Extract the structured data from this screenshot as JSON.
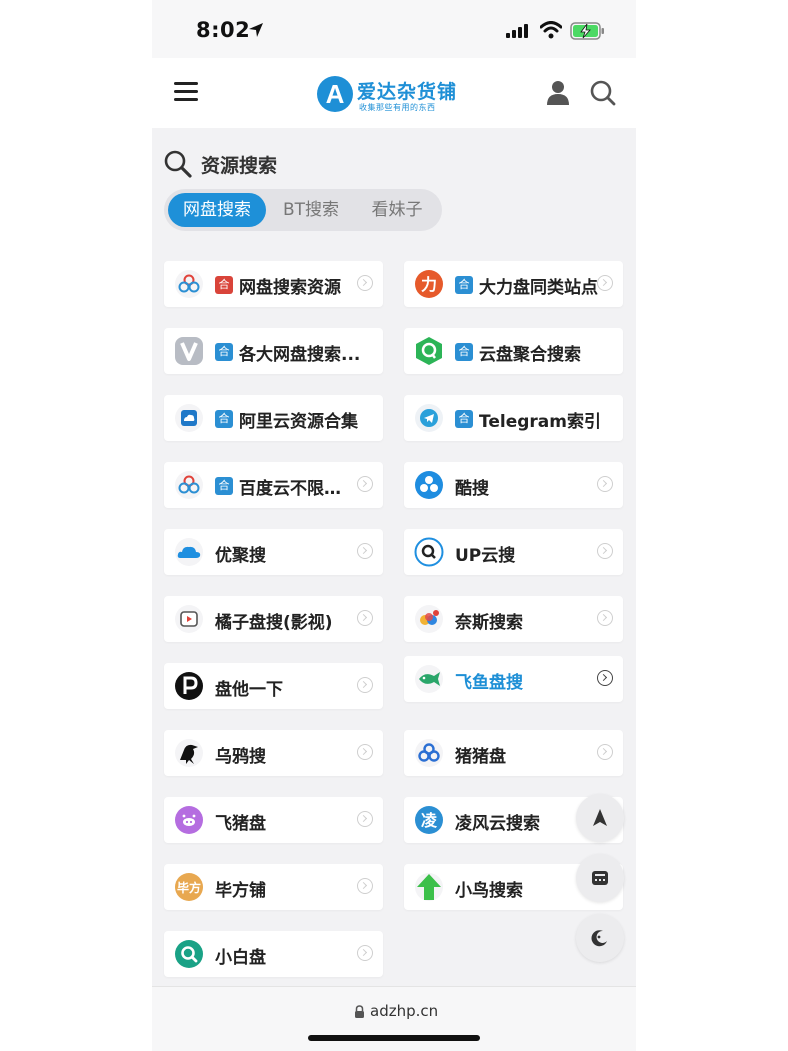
{
  "status_bar": {
    "time": "8:02"
  },
  "header": {
    "logo_letter": "A",
    "logo_title": "爱达杂货铺",
    "logo_subtitle": "收集那些有用的东西"
  },
  "search_section": {
    "title": "资源搜索",
    "tabs": [
      {
        "label": "网盘搜索",
        "active": true
      },
      {
        "label": "BT搜索",
        "active": false
      },
      {
        "label": "看妹子",
        "active": false
      }
    ]
  },
  "tag_char": "合",
  "cards": [
    {
      "label": "网盘搜索资源",
      "tag": true,
      "tag_color": "red",
      "icon": "baidu-cloud-icon"
    },
    {
      "label": "大力盘同类站点",
      "tag": true,
      "icon": "dali-icon"
    },
    {
      "label": "各大网盘搜索...",
      "tag": true,
      "icon": "v-logo-icon"
    },
    {
      "label": "云盘聚合搜索",
      "tag": true,
      "icon": "q-hexagon-icon"
    },
    {
      "label": "阿里云资源合集",
      "tag": true,
      "icon": "aliyun-icon"
    },
    {
      "label": "Telegram索引",
      "tag": true,
      "icon": "telegram-icon"
    },
    {
      "label": "百度云不限速...",
      "tag": true,
      "icon": "baidu-cloud-icon"
    },
    {
      "label": "酷搜",
      "tag": false,
      "icon": "kusou-icon"
    },
    {
      "label": "优聚搜",
      "tag": false,
      "icon": "cloud-icon"
    },
    {
      "label": "UP云搜",
      "tag": false,
      "icon": "magnifier-icon"
    },
    {
      "label": "橘子盘搜(影视)",
      "tag": false,
      "icon": "play-icon"
    },
    {
      "label": "奈斯搜索",
      "tag": false,
      "icon": "colorful-icon"
    },
    {
      "label": "盘他一下",
      "tag": false,
      "icon": "p-logo-icon"
    },
    {
      "label": "飞鱼盘搜",
      "tag": false,
      "icon": "fish-icon",
      "highlight": true
    },
    {
      "label": "乌鸦搜",
      "tag": false,
      "icon": "crow-icon"
    },
    {
      "label": "猪猪盘",
      "tag": false,
      "icon": "zhuzhu-icon"
    },
    {
      "label": "飞猪盘",
      "tag": false,
      "icon": "pig-icon"
    },
    {
      "label": "凌风云搜索",
      "tag": false,
      "icon": "lingfeng-icon"
    },
    {
      "label": "毕方铺",
      "tag": false,
      "icon": "bifang-icon"
    },
    {
      "label": "小鸟搜索",
      "tag": false,
      "icon": "green-arrow-icon"
    },
    {
      "label": "小白盘",
      "tag": false,
      "icon": "xiaobai-icon"
    }
  ],
  "bottom_bar": {
    "url": "adzhp.cn"
  },
  "colors": {
    "accent": "#1e8fd6",
    "background": "#f2f2f4"
  }
}
